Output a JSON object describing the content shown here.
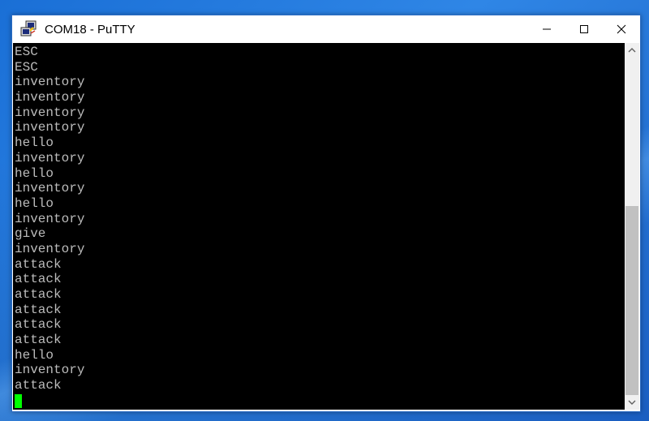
{
  "window": {
    "title": "COM18 - PuTTY",
    "icon": "putty-icon",
    "controls": [
      "minimize-icon",
      "maximize-icon",
      "close-icon"
    ]
  },
  "terminal": {
    "lines": [
      "ESC",
      "ESC",
      "inventory",
      "inventory",
      "inventory",
      "inventory",
      "hello",
      "inventory",
      "hello",
      "inventory",
      "hello",
      "inventory",
      "give",
      "inventory",
      "attack",
      "attack",
      "attack",
      "attack",
      "attack",
      "attack",
      "hello",
      "inventory",
      "attack"
    ],
    "text_color": "#bbbbbb",
    "background": "#000000",
    "cursor_color": "#00ff00"
  },
  "scrollbar": {
    "position_fraction": 1.0,
    "visible_fraction": 0.56,
    "up_icon": "chevron-up-icon",
    "down_icon": "chevron-down-icon"
  }
}
